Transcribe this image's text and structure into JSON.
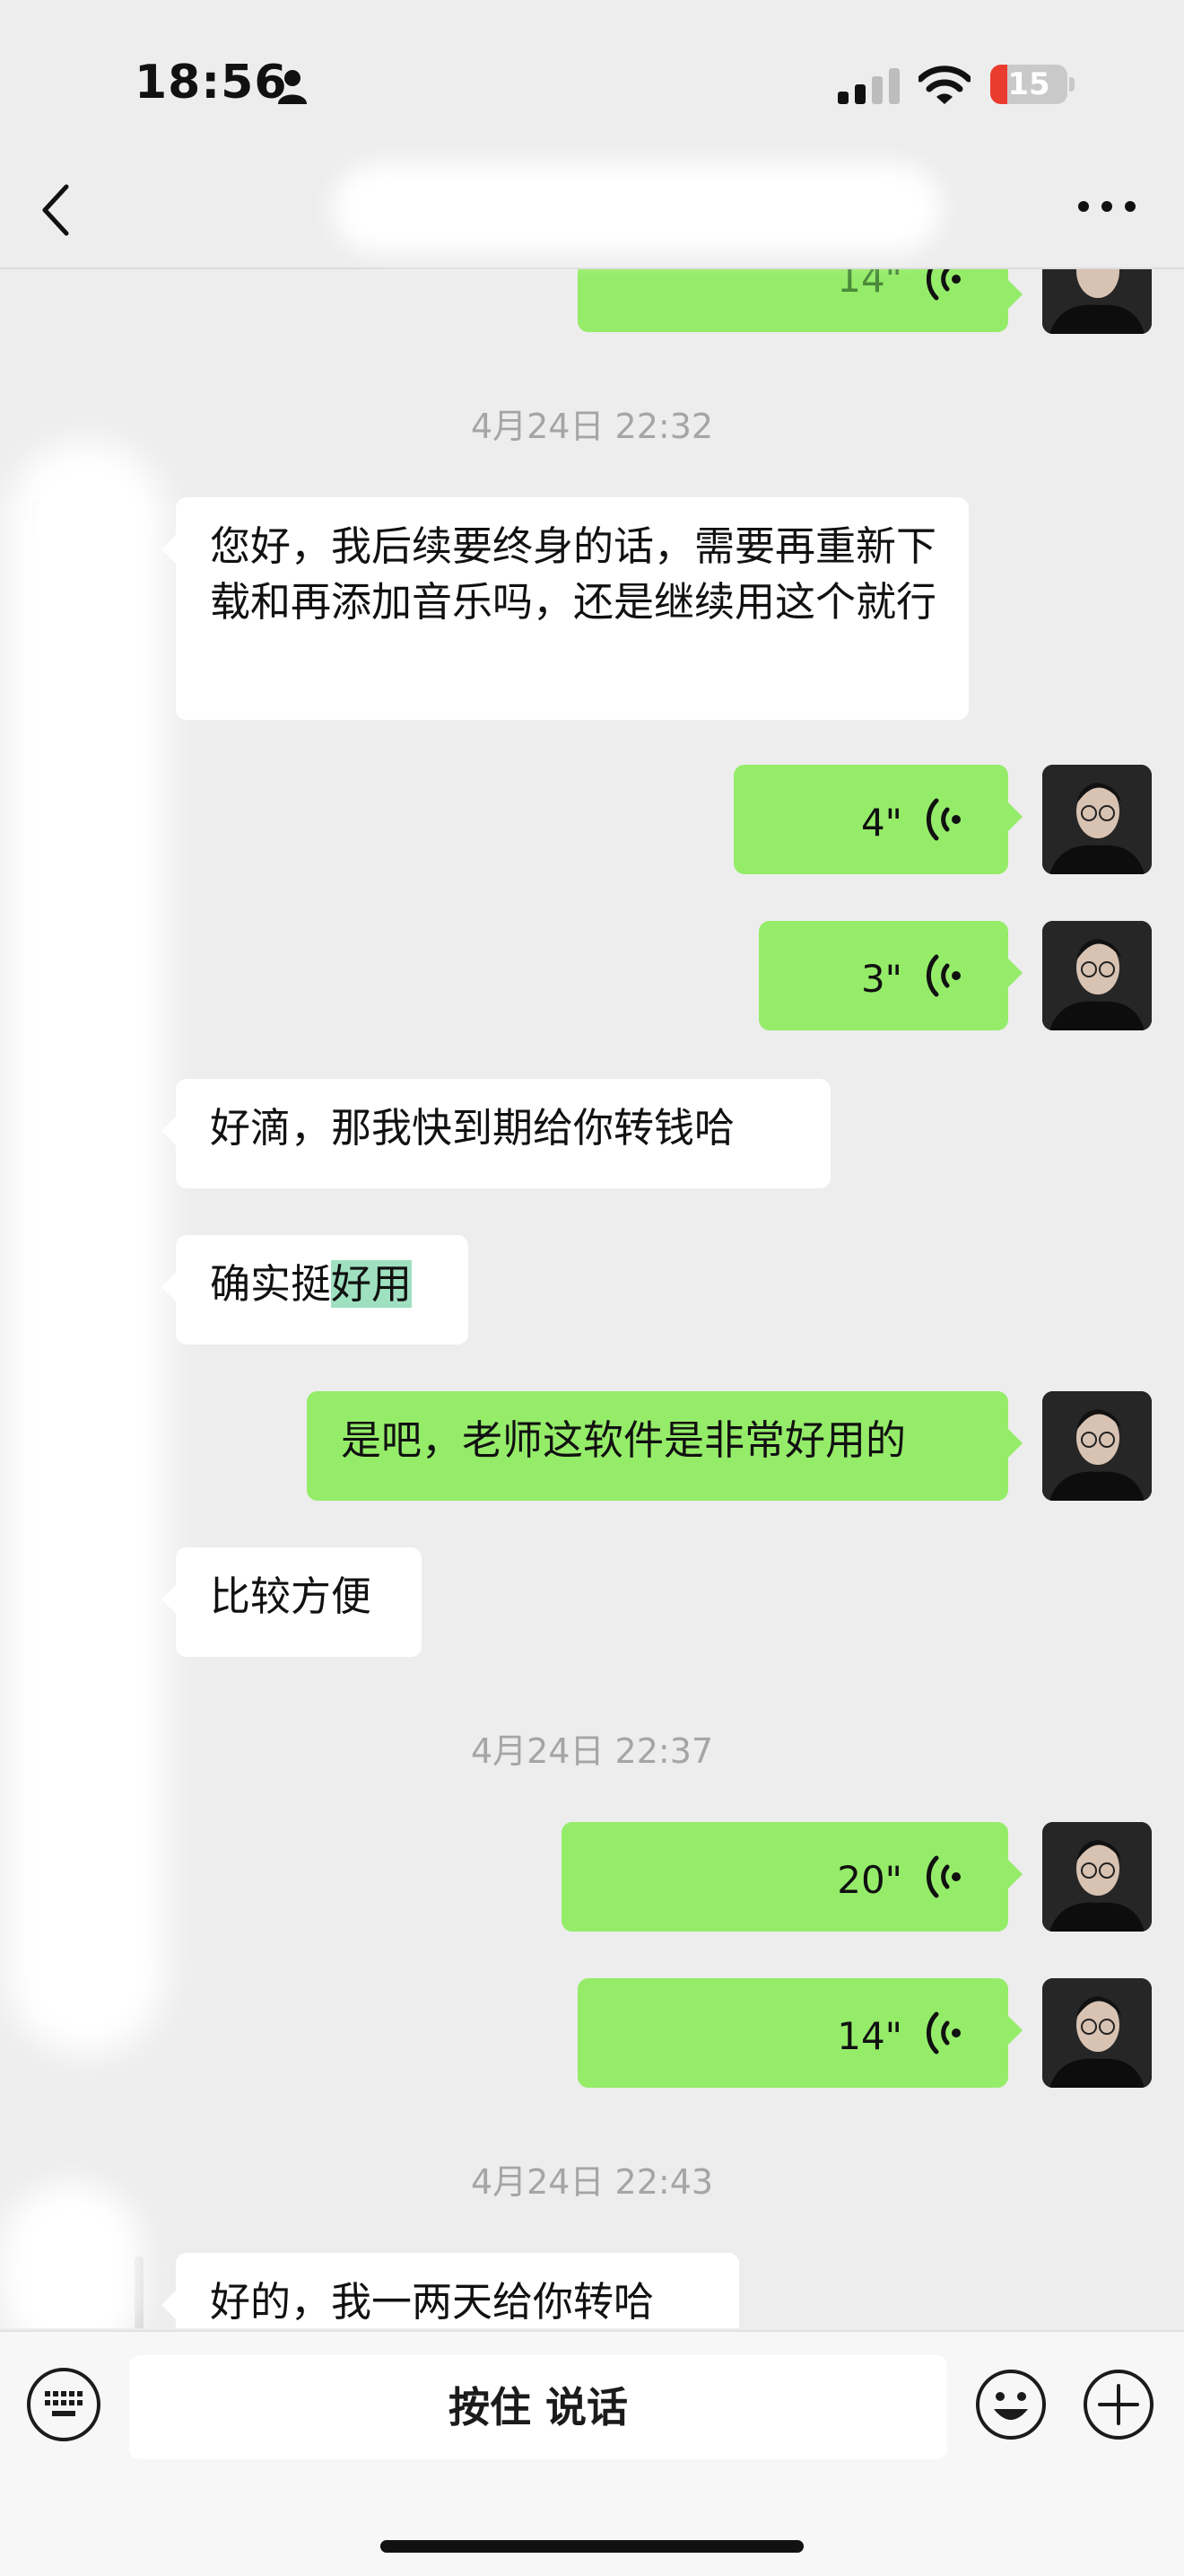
{
  "status_bar": {
    "time": "18:56",
    "battery_level": "15"
  },
  "nav": {
    "back_icon": "chevron-left-icon",
    "more_icon": "more-dots-icon"
  },
  "messages": {
    "partial_voice_duration": "14\"",
    "ts1": "4月24日 22:32",
    "m1": "您好，我后续要终身的话，需要再重新下载和再添加音乐吗，还是继续用这个就行",
    "v1": "4\"",
    "v2": "3\"",
    "m2": "好滴，那我快到期给你转钱哈",
    "m3_prefix": "确实挺",
    "m3_highlight": "好用",
    "m4": "是吧，老师这软件是非常好用的",
    "m5": "比较方便",
    "ts2": "4月24日 22:37",
    "v3": "20\"",
    "v4": "14\"",
    "ts3": "4月24日 22:43",
    "m6": "好的，我一两天给你转哈"
  },
  "input_bar": {
    "hold_to_talk": "按住 说话",
    "keyboard_icon": "keyboard-icon",
    "emoji_icon": "emoji-icon",
    "plus_icon": "plus-icon"
  },
  "colors": {
    "background": "#ededed",
    "outgoing_bubble": "#95ec69",
    "incoming_bubble": "#ffffff",
    "battery_low": "#ea3b2f"
  }
}
